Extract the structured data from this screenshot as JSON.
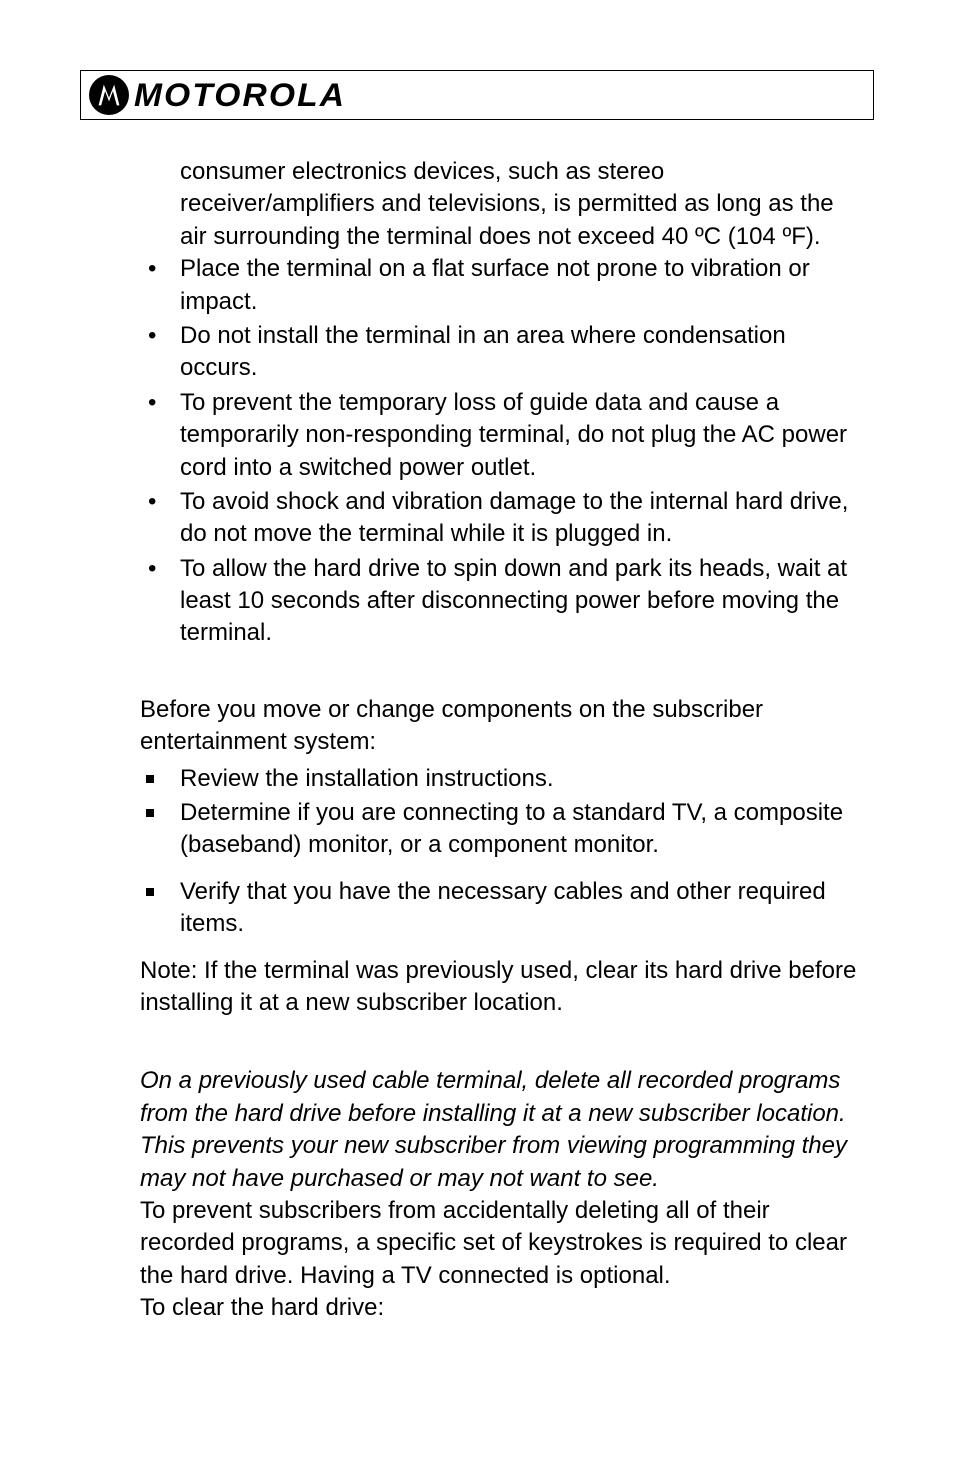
{
  "header": {
    "brand": "MOTOROLA",
    "logo_name": "motorola-logo-icon"
  },
  "body": {
    "continuation": "consumer electronics devices, such as stereo receiver/amplifiers and televisions, is permitted as long as the air surrounding the terminal does not exceed 40 ºC (104 ºF).",
    "bullets": [
      "Place the terminal on a flat surface not prone to vibration or impact.",
      "Do not install the terminal in an area where condensation occurs.",
      "To prevent the temporary loss of guide data and cause a temporarily non-responding terminal, do not plug the AC power cord into a switched power outlet.",
      "To avoid shock and vibration damage to the internal hard drive, do not move the terminal while it is plugged in.",
      "To allow the hard drive to spin down and park its heads, wait at least 10 seconds after disconnecting power before moving the terminal."
    ],
    "para_before_squares": "Before you move or change components on the subscriber entertainment system:",
    "squares": [
      "Review the installation instructions.",
      "Determine if you are connecting to a standard TV, a composite (baseband) monitor, or a component monitor.",
      "Verify that you have the necessary cables and other required items."
    ],
    "note": "Note: If the terminal was previously used, clear its hard drive before installing it at a new subscriber location.",
    "italic": "On a previously used cable terminal, delete all recorded programs from the hard drive before installing it at a new subscriber location. This prevents your new subscriber from viewing programming they may not have purchased or may not want to see.",
    "after_italic_1": "To prevent subscribers from accidentally deleting all of their recorded programs, a specific set of keystrokes is required to clear the hard drive. Having a TV connected is optional.",
    "after_italic_2": "To clear the hard drive:"
  }
}
